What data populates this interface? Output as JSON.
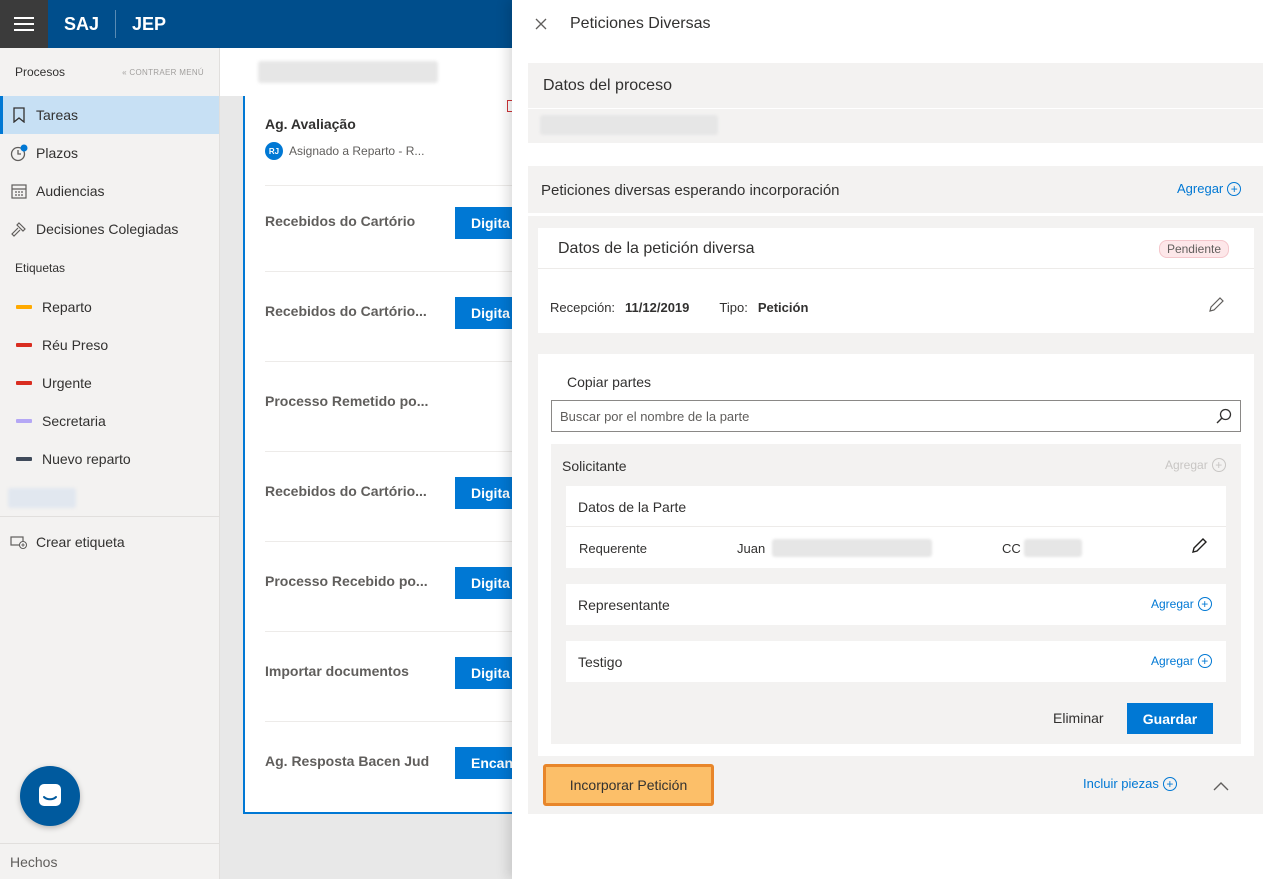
{
  "topbar": {
    "brand1": "SAJ",
    "brand2": "JEP"
  },
  "sidebar": {
    "title": "Procesos",
    "collapse_label": "CONTRAER MENÚ",
    "nav": [
      {
        "label": "Tareas",
        "icon": "bookmark-icon",
        "active": true
      },
      {
        "label": "Plazos",
        "icon": "clock-icon"
      },
      {
        "label": "Audiencias",
        "icon": "calendar-icon"
      },
      {
        "label": "Decisiones Colegiadas",
        "icon": "gavel-icon"
      }
    ],
    "tags_title": "Etiquetas",
    "tags": [
      {
        "label": "Reparto",
        "color": "#ffaa00"
      },
      {
        "label": "Réu Preso",
        "color": "#d92d20"
      },
      {
        "label": "Urgente",
        "color": "#d92d20"
      },
      {
        "label": "Secretaria",
        "color": "#b4a7f5"
      },
      {
        "label": "Nuevo reparto",
        "color": "#3f4a5a"
      }
    ],
    "create_tag": "Crear etiqueta",
    "footer": "Hechos"
  },
  "tasks": {
    "first": {
      "title": "Ag. Avaliação",
      "avatar": "RJ",
      "assigned": "Asignado a Reparto - R..."
    },
    "rows": [
      {
        "title": "Recebidos do Cartório",
        "button": "Digita"
      },
      {
        "title": "Recebidos do Cartório...",
        "button": "Digita"
      },
      {
        "title": "Processo Remetido po...",
        "button": ""
      },
      {
        "title": "Recebidos do Cartório...",
        "button": "Digita"
      },
      {
        "title": "Processo Recebido po...",
        "button": "Digita"
      },
      {
        "title": "Importar documentos",
        "button": "Digita"
      },
      {
        "title": "Ag. Resposta Bacen Jud",
        "button": "Encan"
      }
    ]
  },
  "panel": {
    "title": "Peticiones Diversas",
    "datos_proceso": "Datos del proceso",
    "peticiones_title": "Peticiones diversas esperando incorporación",
    "agregar": "Agregar",
    "peticion": {
      "title": "Datos de la petición diversa",
      "status": "Pendiente",
      "recepcion_label": "Recepción:",
      "recepcion_value": "11/12/2019",
      "tipo_label": "Tipo:",
      "tipo_value": "Petición"
    },
    "copiar_partes": "Copiar partes",
    "search_placeholder": "Buscar por el nombre de la parte",
    "solicitante": "Solicitante",
    "datos_parte": "Datos de la Parte",
    "parte": {
      "rol": "Requerente",
      "nombre": "Juan",
      "doc": "CC"
    },
    "representante": "Representante",
    "testigo": "Testigo",
    "eliminar": "Eliminar",
    "guardar": "Guardar",
    "incorporar": "Incorporar Petición",
    "incluir_piezas": "Incluir piezas"
  }
}
